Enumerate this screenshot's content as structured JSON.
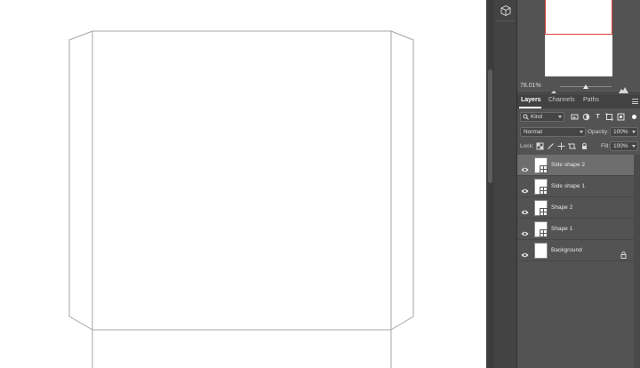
{
  "tool_strip": {
    "icon": "3d-cube-icon"
  },
  "navigator": {
    "zoom": "78.01%"
  },
  "tabs": [
    {
      "label": "Layers",
      "active": true
    },
    {
      "label": "Channels",
      "active": false
    },
    {
      "label": "Paths",
      "active": false
    }
  ],
  "filter": {
    "kind_label": "Kind",
    "icons": [
      "image-filter-icon",
      "adjustment-filter-icon",
      "type-filter-icon",
      "shape-filter-icon",
      "smart-object-filter-icon"
    ]
  },
  "blend": {
    "mode": "Normal",
    "opacity_label": "Opacity:",
    "opacity_value": "100%"
  },
  "lock": {
    "label": "Lock:",
    "fill_label": "Fill:",
    "fill_value": "100%"
  },
  "layers": [
    {
      "name": "Side shape 2",
      "selected": true,
      "type": "shape"
    },
    {
      "name": "Side shape 1",
      "selected": false,
      "type": "shape"
    },
    {
      "name": "Shape 2",
      "selected": false,
      "type": "shape"
    },
    {
      "name": "Shape 1",
      "selected": false,
      "type": "shape"
    },
    {
      "name": "Background",
      "selected": false,
      "type": "background",
      "locked": true
    }
  ],
  "colors": {
    "panel_bg": "#535353",
    "selected_layer": "#6e6e6e",
    "canvas_outline": "#9a9a9a",
    "nav_frame": "#e0413a"
  }
}
